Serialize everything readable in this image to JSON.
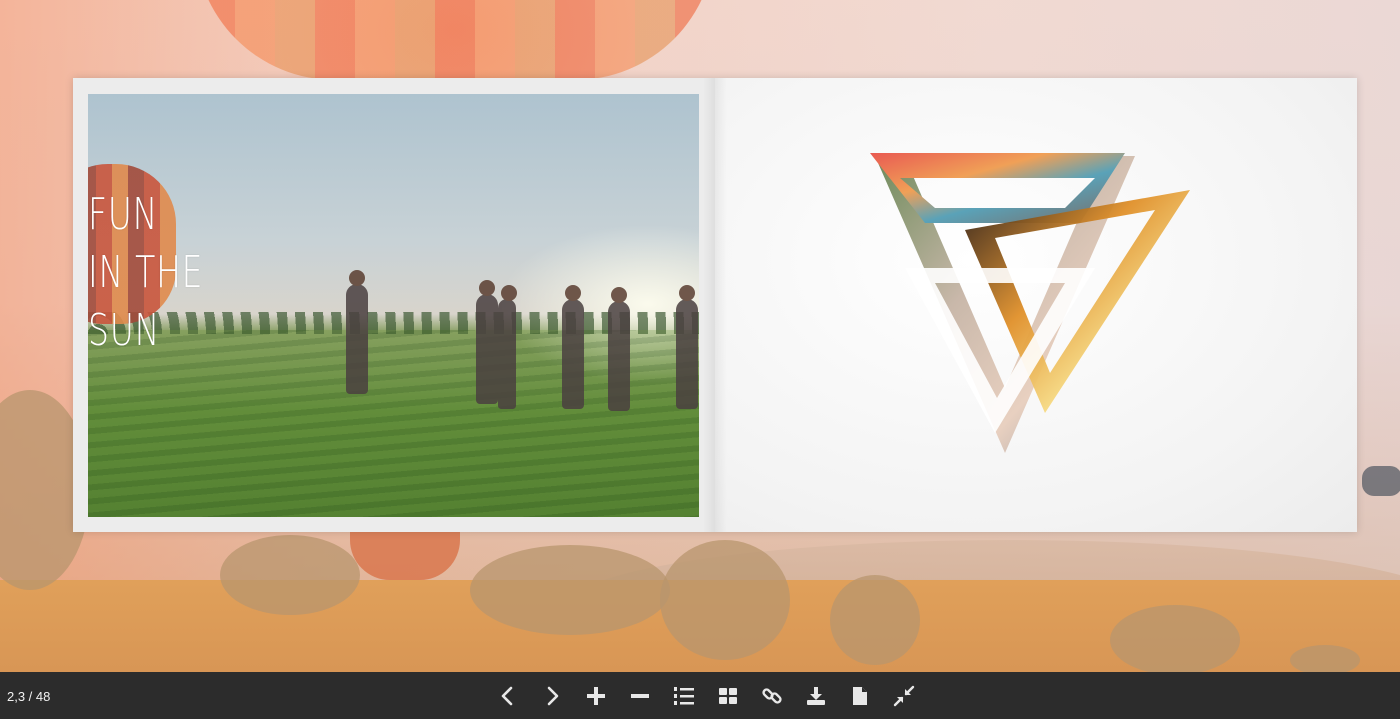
{
  "page_counter": "2,3 / 48",
  "left_page": {
    "headline_lines": [
      "FUN",
      "IN THE",
      "SUN"
    ]
  },
  "toolbar": {
    "buttons": [
      {
        "name": "previous-page-button",
        "icon": "chevron-left-icon"
      },
      {
        "name": "next-page-button",
        "icon": "chevron-right-icon"
      },
      {
        "name": "zoom-in-button",
        "icon": "plus-icon"
      },
      {
        "name": "zoom-out-button",
        "icon": "minus-icon"
      },
      {
        "name": "table-of-contents-button",
        "icon": "numbered-list-icon"
      },
      {
        "name": "thumbnails-button",
        "icon": "grid-icon"
      },
      {
        "name": "share-link-button",
        "icon": "link-icon"
      },
      {
        "name": "download-button",
        "icon": "download-icon"
      },
      {
        "name": "single-page-button",
        "icon": "document-icon"
      },
      {
        "name": "exit-fullscreen-button",
        "icon": "collapse-icon"
      }
    ]
  },
  "colors": {
    "toolbar_bg": "#2c2c2c",
    "toolbar_icon": "#e8e8e8",
    "page_bg": "#f4f4f4"
  }
}
